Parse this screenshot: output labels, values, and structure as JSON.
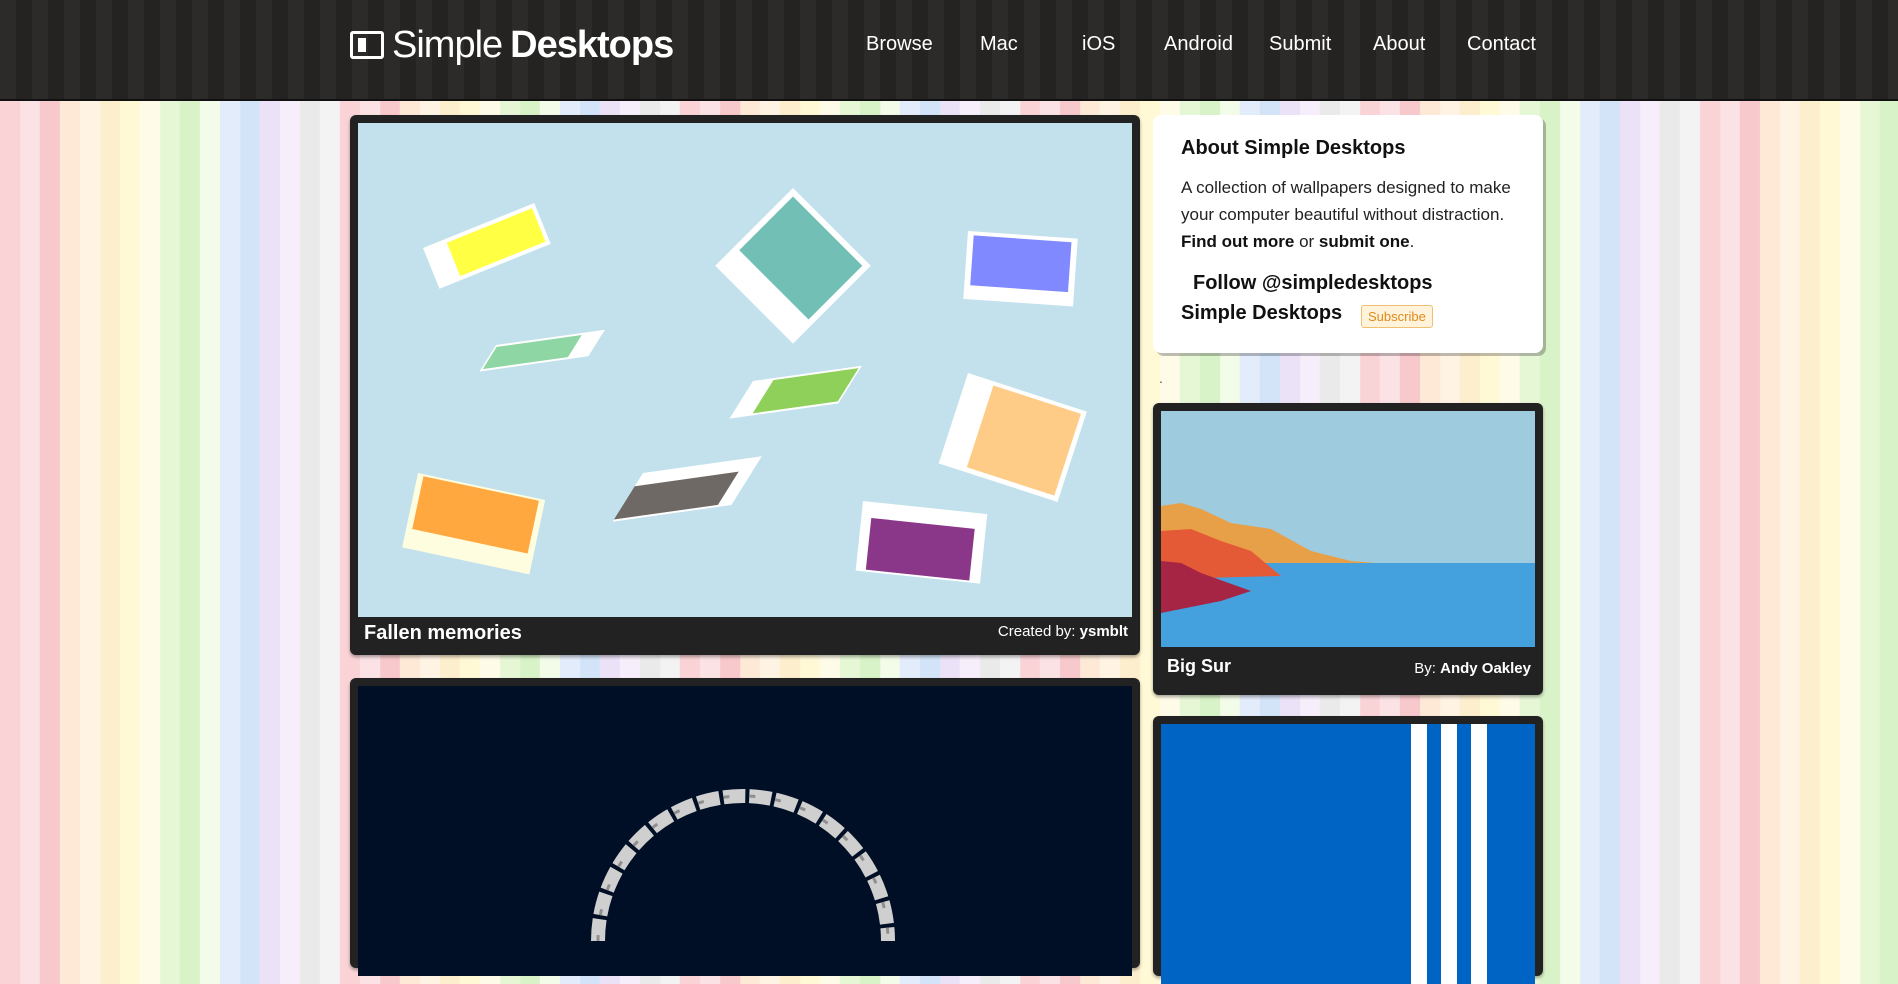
{
  "header": {
    "logo_light": "Simple",
    "logo_bold": "Desktops",
    "nav": [
      "Browse",
      "Mac",
      "iOS",
      "Android",
      "Submit",
      "About",
      "Contact"
    ]
  },
  "main": {
    "featured": {
      "title": "Fallen memories",
      "credit_prefix": "Created by:",
      "author": "ysmblt"
    },
    "second": {}
  },
  "sidebar": {
    "about_title": "About Simple Desktops",
    "about_text": "A collection of wallpapers designed to make your computer beautiful without distraction.",
    "find_out_more": "Find out more",
    "or": "or",
    "submit_one": "submit one",
    "period": ".",
    "follow": "Follow @simpledesktops",
    "simple_desktops": "Simple Desktops",
    "subscribe": "Subscribe",
    "dot": ".",
    "cards": [
      {
        "title": "Big Sur",
        "credit_prefix": "By:",
        "author": "Andy Oakley"
      }
    ]
  },
  "colors": {
    "header_bg": "#262523",
    "card_bg": "#222222",
    "sky": "#c2e1ec",
    "night": "#000f26",
    "sea": "#45a0de",
    "blue_wall": "#0064c4"
  }
}
